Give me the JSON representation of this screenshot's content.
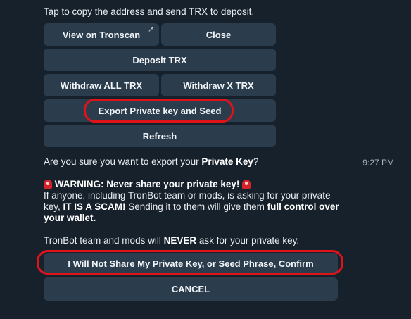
{
  "top_message": "Tap to copy the address and send TRX to deposit.",
  "keyboard1": {
    "view_on_tronscan": "View on Tronscan",
    "view_on_tronscan_icon": "external-link-arrow",
    "close": "Close",
    "deposit": "Deposit TRX",
    "withdraw_all": "Withdraw ALL TRX",
    "withdraw_x": "Withdraw X TRX",
    "export": "Export Private key and Seed",
    "refresh": "Refresh"
  },
  "message2": {
    "question_prefix": "Are you sure you want to export your ",
    "question_bold": "Private Key",
    "question_suffix": "?",
    "time": "9:27 PM",
    "warning_icon": "siren-emoji",
    "warning_title": "WARNING: Never share your private key!",
    "line_a": "If anyone, including TronBot team or mods, is asking for your private key, ",
    "scam_bold": "IT IS A SCAM!",
    "line_b": " Sending it to them will give them ",
    "control_bold": "full control over your wallet.",
    "line_c_prefix": "TronBot team and mods will ",
    "never_bold": "NEVER",
    "line_c_suffix": " ask for your private key."
  },
  "keyboard2": {
    "confirm": "I Will Not Share My Private Key, or Seed Phrase, Confirm",
    "cancel": "CANCEL"
  },
  "colors": {
    "background": "#17212b",
    "button": "#2b3c4d",
    "highlight": "#e0131b"
  }
}
